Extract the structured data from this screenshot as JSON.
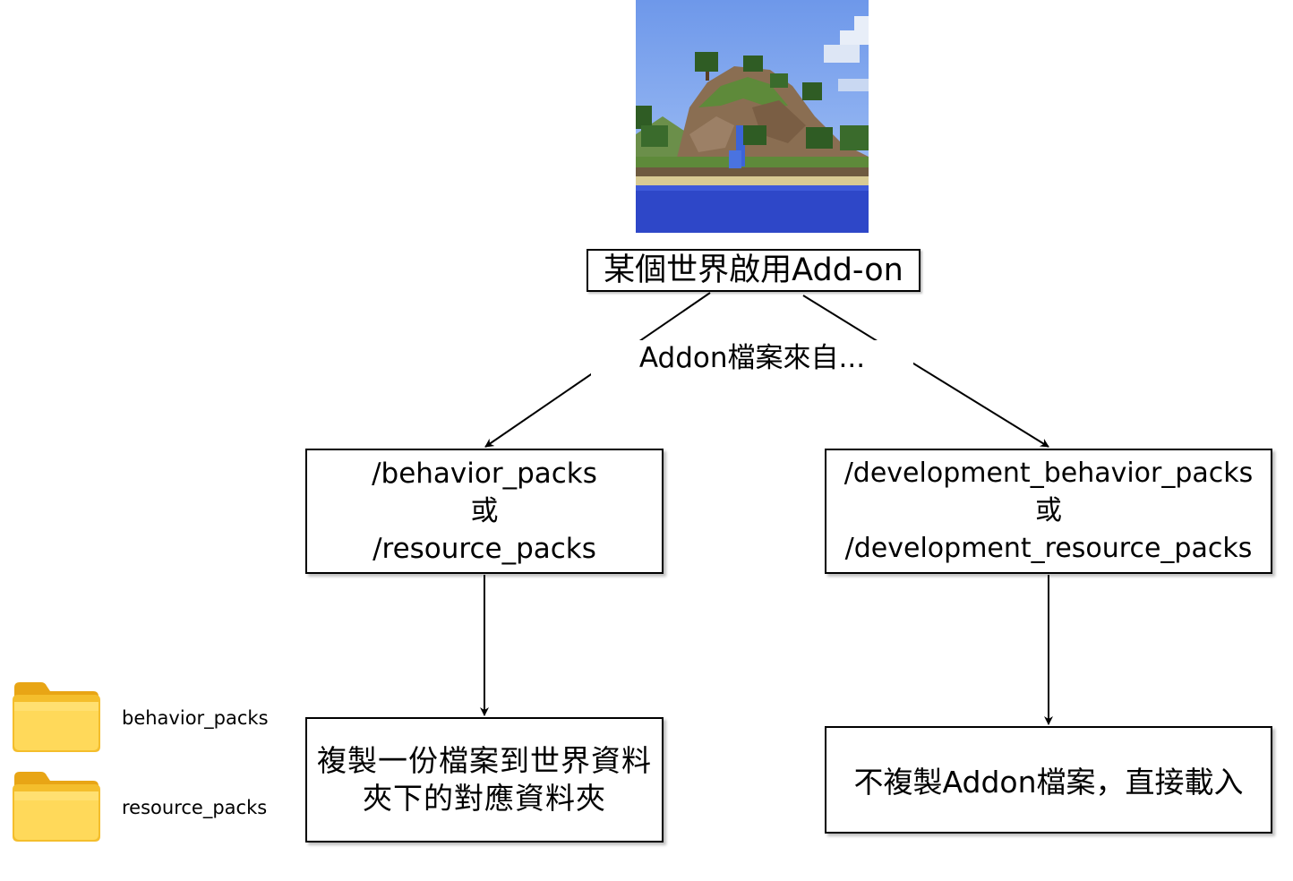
{
  "diagram": {
    "root": {
      "label": "某個世界啟用Add-on"
    },
    "edge_label": "Addon檔案來自...",
    "branches": {
      "left": {
        "lines": [
          "/behavior_packs",
          "或",
          "/resource_packs"
        ],
        "result": "複製一份檔案到世界資料夾下的對應資料夾"
      },
      "right": {
        "lines": [
          "/development_behavior_packs",
          "或",
          "/development_resource_packs"
        ],
        "result": "不複製Addon檔案，直接載入"
      }
    },
    "folders": [
      {
        "label": "behavior_packs",
        "icon": "folder-icon"
      },
      {
        "label": "resource_packs",
        "icon": "folder-icon"
      }
    ],
    "thumbnail": {
      "icon": "minecraft-landscape-image"
    }
  },
  "colors": {
    "stroke": "#000000",
    "box_fill": "#ffffff",
    "folder_light": "#FFD95A",
    "folder_dark": "#E8A515",
    "water": "#2E47C8",
    "sky": "#7FA8F0"
  }
}
